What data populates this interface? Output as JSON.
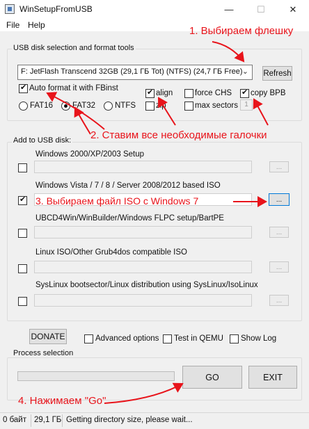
{
  "window": {
    "title": "WinSetupFromUSB",
    "minimize": "—",
    "maximize": "☐",
    "close": "✕"
  },
  "menu": {
    "file": "File",
    "help": "Help"
  },
  "usb_group": {
    "label": "USB disk selection and format tools",
    "disk_value": "F: JetFlash Transcend 32GB (29,1 ГБ Tot) (NTFS) (24,7 ГБ Free)",
    "refresh": "Refresh",
    "auto_format": {
      "label": "Auto format it with FBinst",
      "checked": true
    },
    "fs": {
      "fat16": "FAT16",
      "fat32": "FAT32",
      "ntfs": "NTFS",
      "selected": "FAT32"
    },
    "align": {
      "label": "align",
      "checked": true
    },
    "zip": {
      "label": "zip",
      "checked": false
    },
    "force_chs": {
      "label": "force CHS",
      "checked": false
    },
    "max_sectors": {
      "label": "max sectors",
      "checked": false
    },
    "copy_bpb": {
      "label": "copy BPB",
      "checked": true
    },
    "bpb_value": "1"
  },
  "add_group": {
    "label": "Add to USB disk:",
    "rows": [
      {
        "label": "Windows 2000/XP/2003 Setup",
        "checked": false,
        "value": "",
        "browse": "..."
      },
      {
        "label": "Windows Vista / 7 / 8 / Server 2008/2012 based ISO",
        "checked": true,
        "value": "",
        "browse": "..."
      },
      {
        "label": "UBCD4Win/WinBuilder/Windows FLPC setup/BartPE",
        "checked": false,
        "value": "",
        "browse": "..."
      },
      {
        "label": "Linux ISO/Other Grub4dos compatible ISO",
        "checked": false,
        "value": "",
        "browse": "..."
      },
      {
        "label": "SysLinux bootsector/Linux distribution using SysLinux/IsoLinux",
        "checked": false,
        "value": "",
        "browse": "..."
      }
    ]
  },
  "options": {
    "donate": "DONATE",
    "advanced": {
      "label": "Advanced options",
      "checked": false
    },
    "qemu": {
      "label": "Test in QEMU",
      "checked": false
    },
    "show_log": {
      "label": "Show Log",
      "checked": false
    }
  },
  "process": {
    "label": "Process selection",
    "progress": 0,
    "go": "GO",
    "exit": "EXIT"
  },
  "status": {
    "size": "0 байт",
    "total": "29,1 ГБ",
    "message": "Getting directory size, please wait..."
  },
  "annotations": {
    "step1": "1. Выбираем флешку",
    "step2": "2. Ставим все необходимые галочки",
    "step3": "3. Выбираем файл ISO с Windows 7",
    "step4": "4. Нажимаем \"Go\""
  },
  "colors": {
    "annotation": "#e8141b",
    "accent_border": "#0078d7"
  }
}
